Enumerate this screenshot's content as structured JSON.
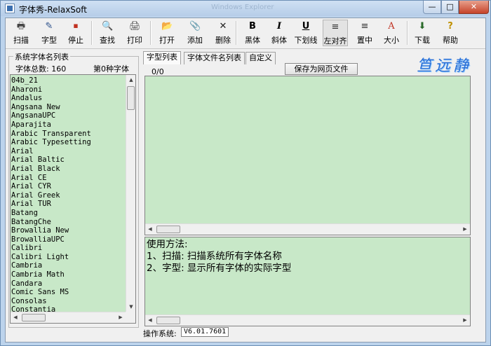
{
  "window": {
    "title": "字体秀-RelaxSoft",
    "background_title": "Windows Explorer"
  },
  "window_controls": {
    "minimize": "—",
    "maximize": "□",
    "close": "✕"
  },
  "toolbar": [
    {
      "label": "扫描",
      "icon": "printer-icon",
      "glyph": "🖶"
    },
    {
      "label": "字型",
      "icon": "font-icon",
      "glyph": "✎"
    },
    {
      "label": "停止",
      "icon": "stop-icon",
      "glyph": "⏹"
    },
    {
      "label": "查找",
      "icon": "find-icon",
      "glyph": "🔍"
    },
    {
      "label": "打印",
      "icon": "print-icon",
      "glyph": "🖨"
    },
    {
      "label": "打开",
      "icon": "open-folder-icon",
      "glyph": "📂"
    },
    {
      "label": "添加",
      "icon": "paperclip-icon",
      "glyph": "📎"
    },
    {
      "label": "删除",
      "icon": "delete-x-icon",
      "glyph": "✕"
    },
    {
      "label": "黑体",
      "icon": "bold-icon",
      "glyph": "B"
    },
    {
      "label": "斜体",
      "icon": "italic-icon",
      "glyph": "I"
    },
    {
      "label": "下划线",
      "icon": "underline-icon",
      "glyph": "U"
    },
    {
      "label": "左对齐",
      "icon": "align-left-icon",
      "glyph": "≡"
    },
    {
      "label": "置中",
      "icon": "align-center-icon",
      "glyph": "≡"
    },
    {
      "label": "大小",
      "icon": "size-icon",
      "glyph": "A"
    },
    {
      "label": "下载",
      "icon": "download-icon",
      "glyph": "⬇"
    },
    {
      "label": "帮助",
      "icon": "help-icon",
      "glyph": "?"
    }
  ],
  "left_panel": {
    "group_title": "系统字体名列表",
    "count_label": "字体总数: 160",
    "nth_label": "第0种字体",
    "fonts": [
      "04b_21",
      "Aharoni",
      "Andalus",
      "Angsana New",
      "AngsanaUPC",
      "Aparajita",
      "Arabic Transparent",
      "Arabic Typesetting",
      "Arial",
      "Arial Baltic",
      "Arial Black",
      "Arial CE",
      "Arial CYR",
      "Arial Greek",
      "Arial TUR",
      "Batang",
      "BatangChe",
      "Browallia New",
      "BrowalliaUPC",
      "Calibri",
      "Calibri Light",
      "Cambria",
      "Cambria Math",
      "Candara",
      "Comic Sans MS",
      "Consolas",
      "Constantia"
    ]
  },
  "tabs": [
    {
      "label": "字型列表",
      "active": true
    },
    {
      "label": "字体文件名列表",
      "active": false
    },
    {
      "label": "自定义",
      "active": false
    }
  ],
  "logo_text": "笪远静",
  "progress_text": "0/0",
  "save_button": "保存为网页文件",
  "help_lines": [
    "使用方法:",
    "1、扫描: 扫描系统所有字体名称",
    "2、字型: 显示所有字体的实际字型"
  ],
  "status": {
    "label": "操作系统:",
    "value": "V6.01.7601"
  },
  "scroll": {
    "up": "▲",
    "down": "▼",
    "left": "◀",
    "right": "▶"
  },
  "colors": {
    "list_bg": "#c8e8c8",
    "window_frame": "#bcd3ec",
    "logo": "#2a6fd6"
  }
}
